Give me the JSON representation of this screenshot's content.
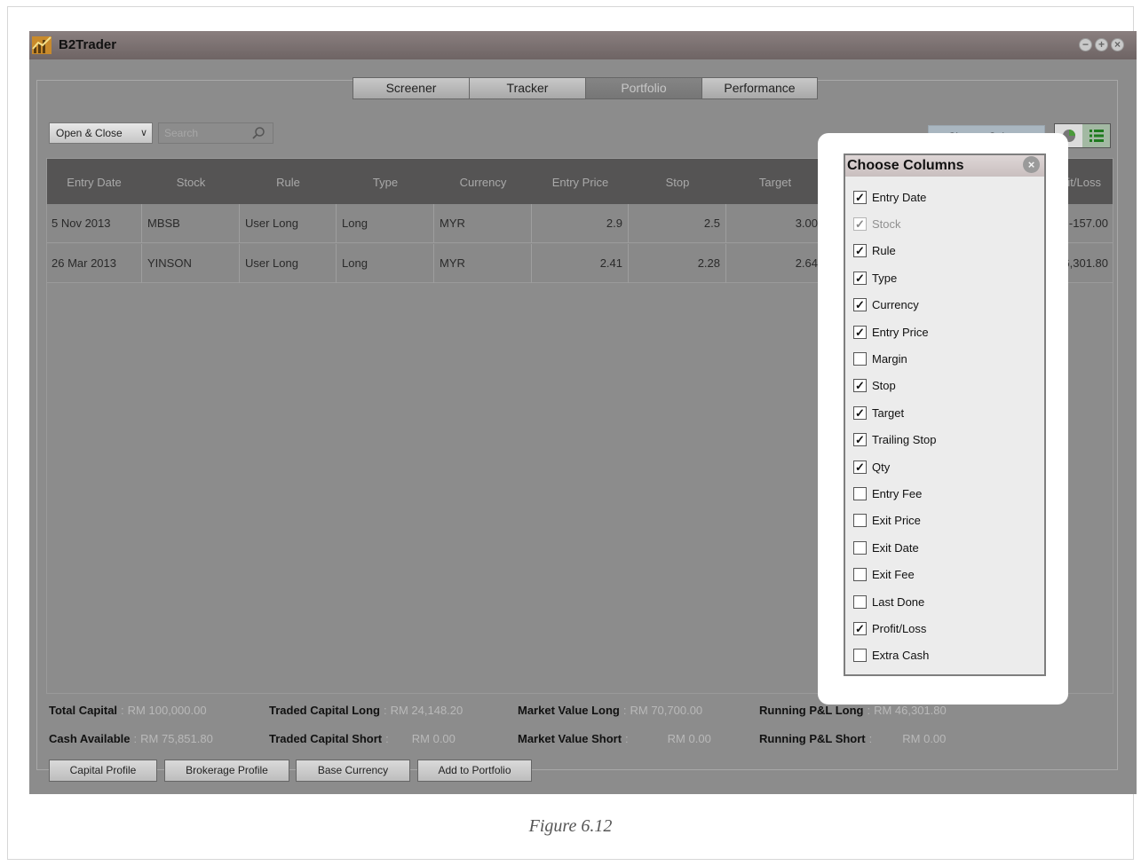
{
  "app": {
    "title": "B2Trader"
  },
  "tabs": [
    {
      "label": "Screener",
      "active": false
    },
    {
      "label": "Tracker",
      "active": false
    },
    {
      "label": "Portfolio",
      "active": true
    },
    {
      "label": "Performance",
      "active": false
    }
  ],
  "toolbar": {
    "filter_value": "Open & Close",
    "search_placeholder": "Search",
    "change_column_label": "Change Column"
  },
  "grid": {
    "columns": [
      "Entry Date",
      "Stock",
      "Rule",
      "Type",
      "Currency",
      "Entry Price",
      "Stop",
      "Target",
      "Profit/Loss"
    ],
    "rows": [
      {
        "entry_date": "5 Nov 2013",
        "stock": "MBSB",
        "rule": "User Long",
        "type": "Long",
        "currency": "MYR",
        "entry_price": "2.9",
        "stop": "2.5",
        "target": "3.00",
        "profit_loss": "-157.00"
      },
      {
        "entry_date": "26 Mar 2013",
        "stock": "YINSON",
        "rule": "User Long",
        "type": "Long",
        "currency": "MYR",
        "entry_price": "2.41",
        "stop": "2.28",
        "target": "2.64",
        "profit_loss": "46,301.80"
      }
    ]
  },
  "summary": {
    "total_capital": {
      "label": "Total Capital",
      "value": "RM 100,000.00"
    },
    "cash_available": {
      "label": "Cash Available",
      "value": "RM 75,851.80"
    },
    "traded_capital_long": {
      "label": "Traded Capital Long",
      "value": "RM 24,148.20"
    },
    "traded_capital_short": {
      "label": "Traded Capital Short",
      "value": "RM 0.00"
    },
    "market_value_long": {
      "label": "Market Value Long",
      "value": "RM 70,700.00"
    },
    "market_value_short": {
      "label": "Market Value Short",
      "value": "RM 0.00"
    },
    "running_pl_long": {
      "label": "Running P&L Long",
      "value": "RM 46,301.80"
    },
    "running_pl_short": {
      "label": "Running P&L Short",
      "value": "RM 0.00"
    }
  },
  "buttons": {
    "capital_profile": "Capital Profile",
    "brokerage_profile": "Brokerage Profile",
    "base_currency": "Base Currency",
    "add_to_portfolio": "Add to Portfolio"
  },
  "choose_columns": {
    "title": "Choose Columns",
    "options": [
      {
        "label": "Entry Date",
        "checked": true,
        "disabled": false
      },
      {
        "label": "Stock",
        "checked": true,
        "disabled": true
      },
      {
        "label": "Rule",
        "checked": true,
        "disabled": false
      },
      {
        "label": "Type",
        "checked": true,
        "disabled": false
      },
      {
        "label": "Currency",
        "checked": true,
        "disabled": false
      },
      {
        "label": "Entry Price",
        "checked": true,
        "disabled": false
      },
      {
        "label": "Margin",
        "checked": false,
        "disabled": false
      },
      {
        "label": "Stop",
        "checked": true,
        "disabled": false
      },
      {
        "label": "Target",
        "checked": true,
        "disabled": false
      },
      {
        "label": "Trailing Stop",
        "checked": true,
        "disabled": false
      },
      {
        "label": "Qty",
        "checked": true,
        "disabled": false
      },
      {
        "label": "Entry Fee",
        "checked": false,
        "disabled": false
      },
      {
        "label": "Exit Price",
        "checked": false,
        "disabled": false
      },
      {
        "label": "Exit Date",
        "checked": false,
        "disabled": false
      },
      {
        "label": "Exit Fee",
        "checked": false,
        "disabled": false
      },
      {
        "label": "Last Done",
        "checked": false,
        "disabled": false
      },
      {
        "label": "Profit/Loss",
        "checked": true,
        "disabled": false
      },
      {
        "label": "Extra Cash",
        "checked": false,
        "disabled": false
      }
    ]
  },
  "caption": "Figure 6.12",
  "icons": {
    "logo": "chart-logo-icon",
    "search": "search-icon",
    "chart_view": "pie-chart-icon",
    "list_view": "list-icon",
    "close": "close-icon"
  },
  "colors": {
    "app_bg": "#8c8c8c",
    "header_bg": "#555454",
    "active_tab": "#767676",
    "change_column_bg": "#a9b6c0"
  }
}
